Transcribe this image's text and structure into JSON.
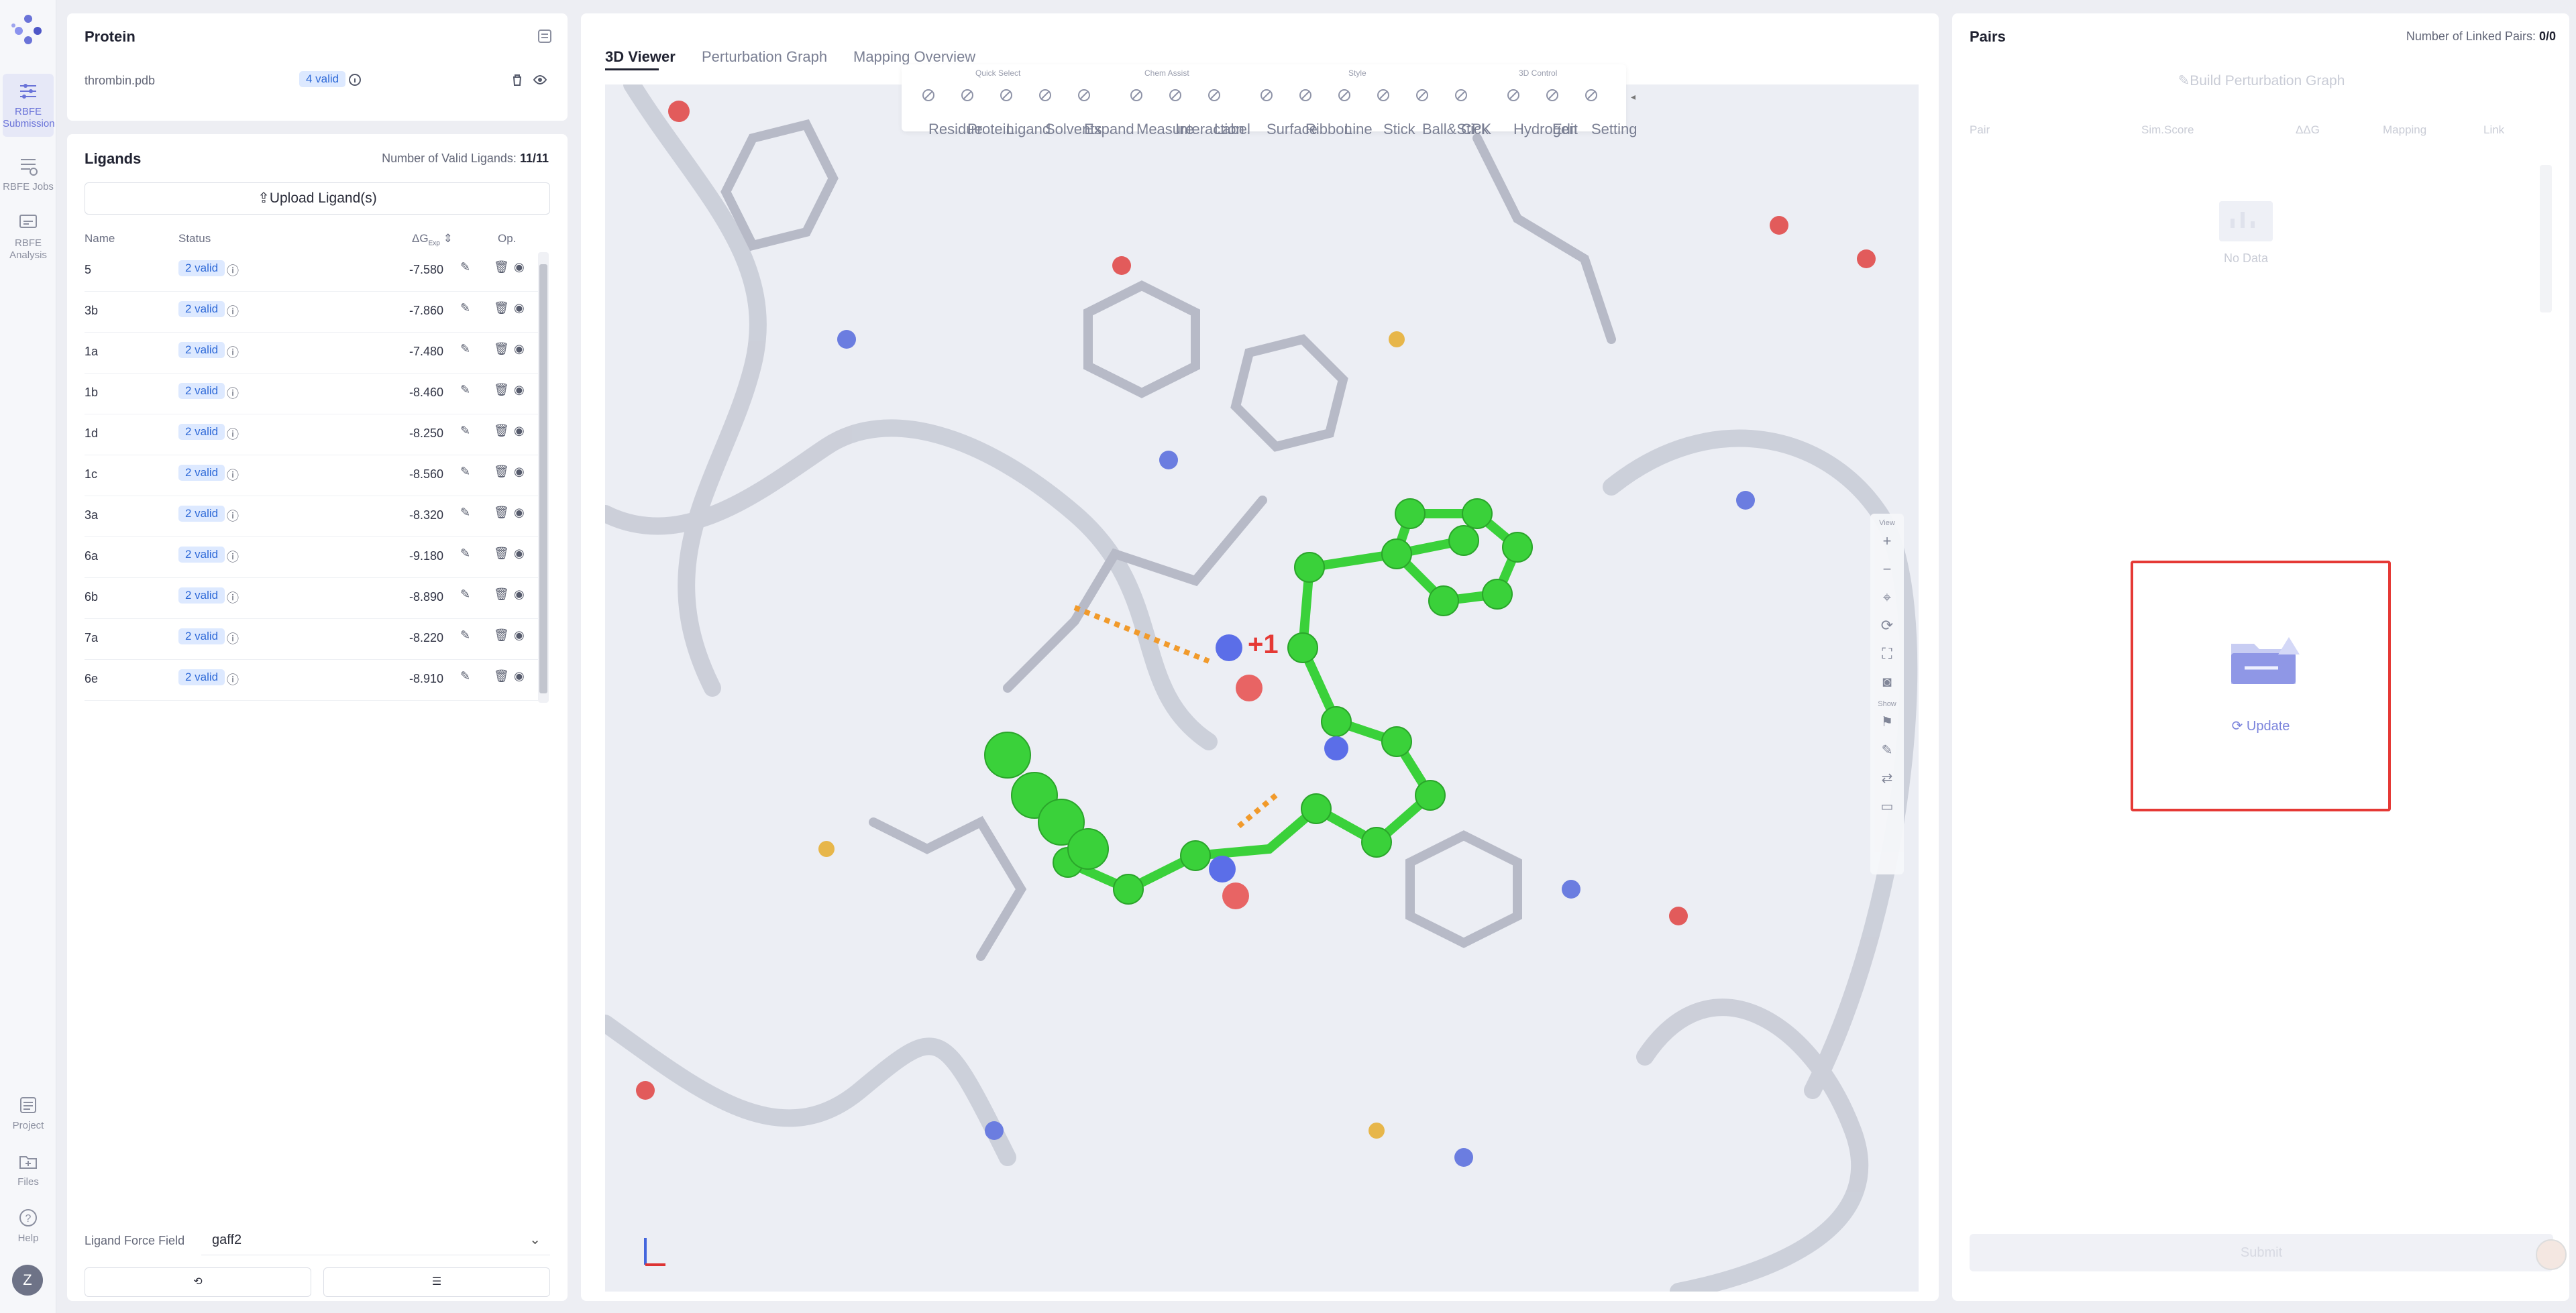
{
  "nav": {
    "items": [
      {
        "label": "RBFE\nSubmission"
      },
      {
        "label": "RBFE Jobs"
      },
      {
        "label": "RBFE\nAnalysis"
      }
    ],
    "bottom": [
      {
        "label": "Project"
      },
      {
        "label": "Files"
      },
      {
        "label": "Help"
      }
    ],
    "avatar": "Z"
  },
  "protein": {
    "title": "Protein",
    "file": "thrombin.pdb",
    "valid": "4 valid"
  },
  "ligands": {
    "title": "Ligands",
    "count_label": "Number of Valid Ligands:",
    "count": "11/11",
    "upload": "Upload Ligand(s)",
    "columns": {
      "name": "Name",
      "status": "Status",
      "dg": "ΔG",
      "dg_sub": "Exp",
      "op": "Op."
    },
    "rows": [
      {
        "name": "5",
        "status": "2 valid",
        "dg": "-7.580"
      },
      {
        "name": "3b",
        "status": "2 valid",
        "dg": "-7.860"
      },
      {
        "name": "1a",
        "status": "2 valid",
        "dg": "-7.480"
      },
      {
        "name": "1b",
        "status": "2 valid",
        "dg": "-8.460"
      },
      {
        "name": "1d",
        "status": "2 valid",
        "dg": "-8.250"
      },
      {
        "name": "1c",
        "status": "2 valid",
        "dg": "-8.560"
      },
      {
        "name": "3a",
        "status": "2 valid",
        "dg": "-8.320"
      },
      {
        "name": "6a",
        "status": "2 valid",
        "dg": "-9.180"
      },
      {
        "name": "6b",
        "status": "2 valid",
        "dg": "-8.890"
      },
      {
        "name": "7a",
        "status": "2 valid",
        "dg": "-8.220"
      },
      {
        "name": "6e",
        "status": "2 valid",
        "dg": "-8.910"
      }
    ],
    "forcefield_label": "Ligand Force Field",
    "forcefield_value": "gaff2"
  },
  "viewer": {
    "tabs": [
      "3D Viewer",
      "Perturbation Graph",
      "Mapping Overview"
    ],
    "active_tab": "3D Viewer",
    "toolbar": {
      "groups": [
        "Quick Select",
        "Chem Assist",
        "Style",
        "3D Control"
      ],
      "tools": [
        "Residue",
        "Protein",
        "Ligand",
        "Solvents",
        "Expand",
        "Measure",
        "Interaction",
        "Label",
        "Surface",
        "Ribbon",
        "Line",
        "Stick",
        "Ball&Stick",
        "CPK",
        "Hydrogen",
        "Edit",
        "Setting"
      ]
    },
    "side": {
      "view": "View",
      "show": "Show"
    },
    "charge_label": "+1"
  },
  "pairs": {
    "title": "Pairs",
    "linked_label": "Number of Linked Pairs:",
    "linked": "0/0",
    "build": "Build Perturbation Graph",
    "columns": [
      "Pair",
      "Sim.Score",
      "ΔΔG",
      "Mapping",
      "Link"
    ],
    "no_data": "No Data",
    "update": "Update",
    "submit": "Submit"
  },
  "colors": {
    "accent": "#6a73d8",
    "highlight": "#e53935",
    "ligand": "#3ad13a"
  }
}
